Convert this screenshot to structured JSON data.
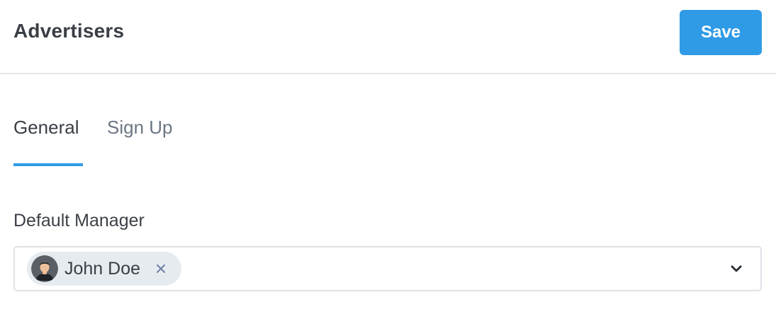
{
  "header": {
    "title": "Advertisers",
    "save_label": "Save"
  },
  "tabs": [
    {
      "label": "General",
      "active": true
    },
    {
      "label": "Sign Up",
      "active": false
    }
  ],
  "form": {
    "default_manager": {
      "label": "Default Manager",
      "selected": [
        {
          "name": "John Doe",
          "avatar_icon": "user-avatar-icon"
        }
      ],
      "dropdown_icon": "chevron-down-icon",
      "remove_icon": "close-icon"
    }
  },
  "colors": {
    "accent": "#2f9ae6",
    "title_text": "#3a3f46",
    "inactive_tab": "#6b7683",
    "chip_background": "#e6ebf0",
    "border": "#dfe3e7"
  }
}
